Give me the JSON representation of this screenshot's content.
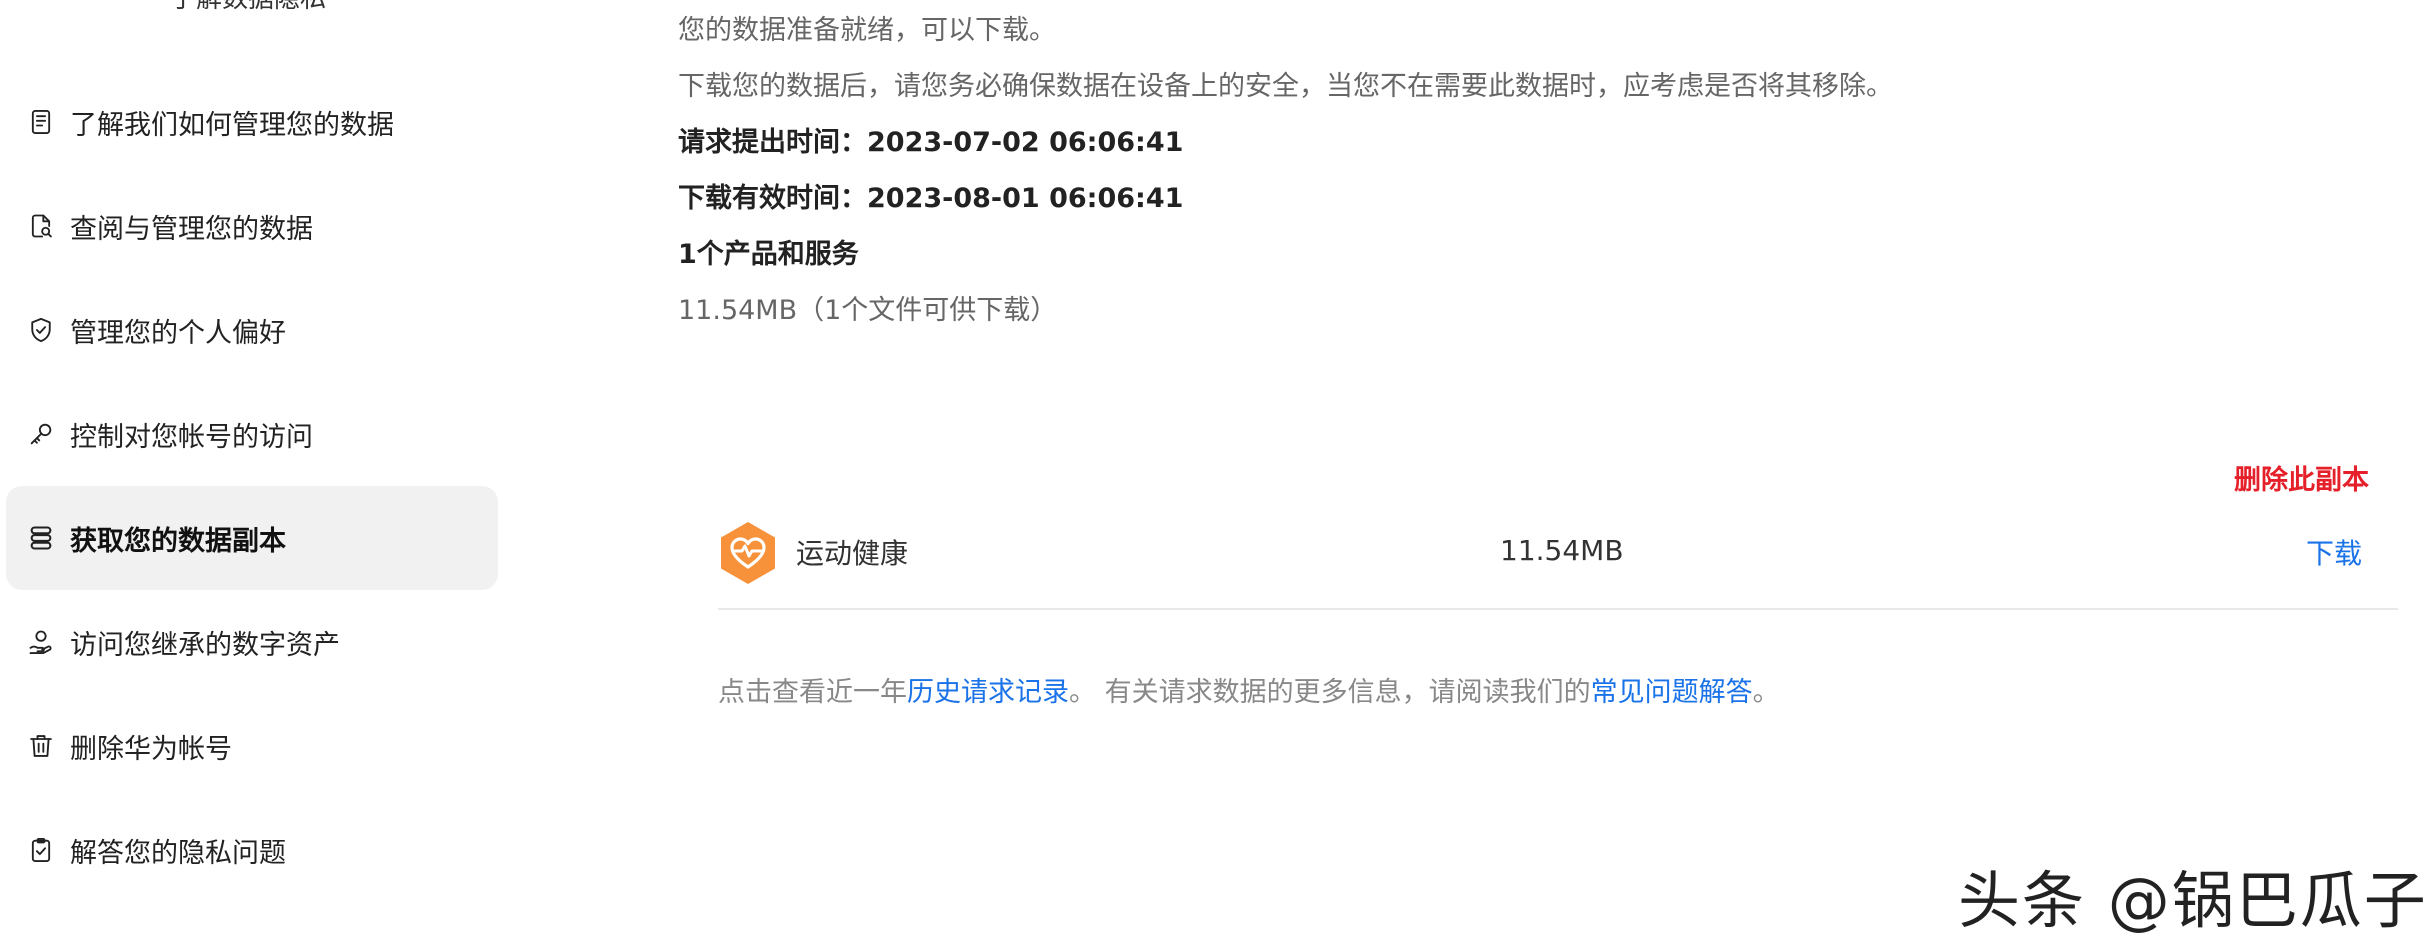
{
  "sidebar": {
    "top_cut_text": "了解数据隐私",
    "items": [
      {
        "label": "了解我们如何管理您的数据",
        "icon": "document-list-icon",
        "active": false
      },
      {
        "label": "查阅与管理您的数据",
        "icon": "document-search-icon",
        "active": false
      },
      {
        "label": "管理您的个人偏好",
        "icon": "shield-check-icon",
        "active": false
      },
      {
        "label": "控制对您帐号的访问",
        "icon": "key-icon",
        "active": false
      },
      {
        "label": "获取您的数据副本",
        "icon": "database-icon",
        "active": true
      },
      {
        "label": "访问您继承的数字资产",
        "icon": "user-hand-icon",
        "active": false
      },
      {
        "label": "删除华为帐号",
        "icon": "trash-icon",
        "active": false
      },
      {
        "label": "解答您的隐私问题",
        "icon": "clipboard-check-icon",
        "active": false
      }
    ]
  },
  "main": {
    "ready_text": "您的数据准备就绪，可以下载。",
    "warning_text": "下载您的数据后，请您务必确保数据在设备上的安全，当您不在需要此数据时，应考虑是否将其移除。",
    "request_time": "请求提出时间：2023-07-02 06:06:41",
    "expire_time": "下载有效时间：2023-08-01 06:06:41",
    "product_count": "1个产品和服务",
    "total_size": "11.54MB（1个文件可供下载）",
    "delete_copy_label": "删除此副本",
    "files": [
      {
        "app_name": "运动健康",
        "size": "11.54MB",
        "download_label": "下载",
        "icon": "health-app-icon"
      }
    ],
    "footer": {
      "prefix": "点击查看近一年",
      "history_link": "历史请求记录",
      "middle": "。 有关请求数据的更多信息，请阅读我们的",
      "faq_link": "常见问题解答",
      "suffix": "。"
    }
  },
  "watermark": "头条 @锅巴瓜子",
  "colors": {
    "accent_link": "#1a73e8",
    "danger": "#e5202a",
    "active_bg": "#f1f1f1",
    "health_orange": "#f7923a"
  }
}
